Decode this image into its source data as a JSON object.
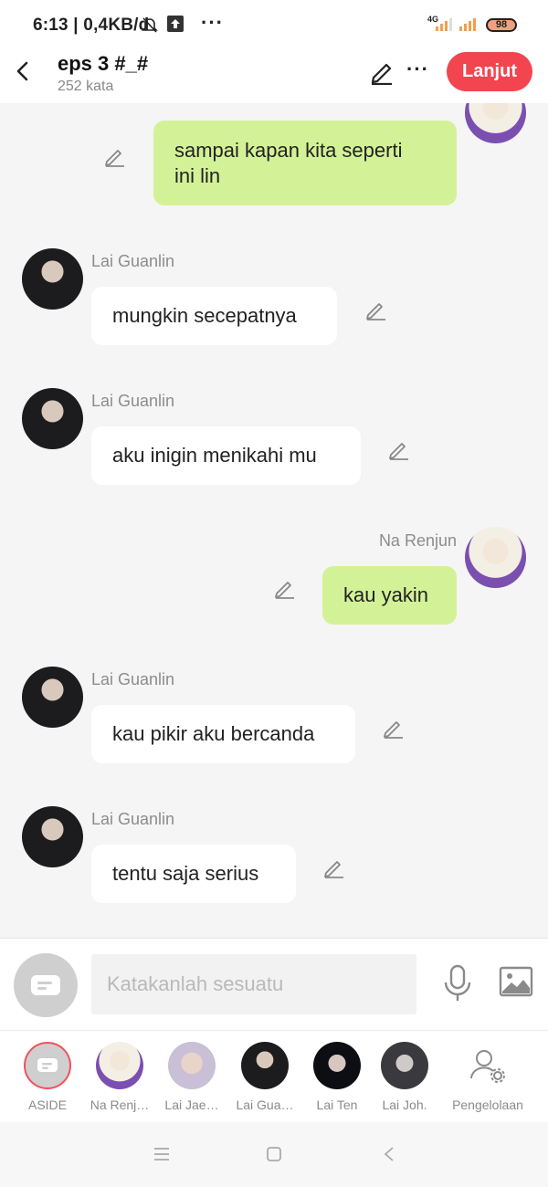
{
  "status_bar": {
    "text": "6:13 | 0,4KB/d",
    "network": "4G",
    "battery": "98"
  },
  "header": {
    "title": "eps 3 #_#",
    "subtitle": "252 kata",
    "continue_label": "Lanjut"
  },
  "messages": [
    {
      "side": "right",
      "sender": "",
      "text_lines": [
        "sampai kapan kita seperti",
        "ini lin"
      ]
    },
    {
      "side": "left",
      "sender": "Lai Guanlin",
      "text": "mungkin secepatnya"
    },
    {
      "side": "left",
      "sender": "Lai Guanlin",
      "text": "aku inigin menikahi mu"
    },
    {
      "side": "right",
      "sender": "Na Renjun",
      "text": "kau yakin"
    },
    {
      "side": "left",
      "sender": "Lai Guanlin",
      "text": "kau pikir aku bercanda"
    },
    {
      "side": "left",
      "sender": "Lai Guanlin",
      "text": "tentu saja serius"
    }
  ],
  "input": {
    "placeholder": "Katakanlah sesuatu"
  },
  "characters": [
    {
      "label": "ASIDE",
      "icon": "aside-icon"
    },
    {
      "label": "Na Renj…",
      "icon": "avatar-light"
    },
    {
      "label": "Lai Jae…",
      "icon": "avatar-light"
    },
    {
      "label": "Lai Gua…",
      "icon": "avatar-dark"
    },
    {
      "label": "Lai Ten",
      "icon": "avatar-dark"
    },
    {
      "label": "Lai Joh.",
      "icon": "avatar-dark"
    },
    {
      "label": "Pengelolaan",
      "icon": "user-settings-icon"
    }
  ],
  "colors": {
    "accent": "#f24550",
    "bubble_right": "#d3f297",
    "bubble_left": "#ffffff",
    "background": "#f5f5f5"
  }
}
